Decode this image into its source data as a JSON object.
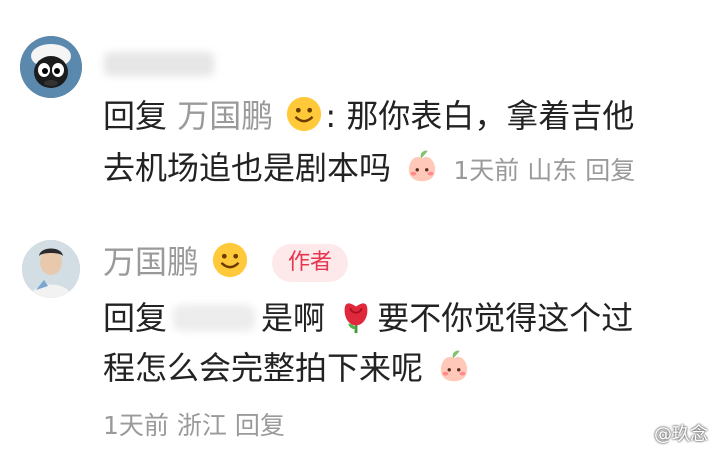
{
  "comment1": {
    "line1_prefix": "回复",
    "reply_to": "万国鹏",
    "line1_text": ": 那你表白，拿着吉他",
    "line2_text": "去机场追也是剧本吗",
    "time": "1天前",
    "location": "山东",
    "reply_label": "回复"
  },
  "comment2": {
    "author_name": "万国鹏",
    "author_badge": "作者",
    "line1_prefix": "回复",
    "line1_text": "是啊",
    "line1_text2": "要不你觉得这个过",
    "line2_text": "程怎么会完整拍下来呢",
    "time": "1天前",
    "location": "浙江",
    "reply_label": "回复"
  },
  "watermark": "@玖念",
  "icons": {
    "smile": "smile-emoji-icon",
    "peach": "peach-emoji-icon",
    "rose": "rose-emoji-icon"
  }
}
